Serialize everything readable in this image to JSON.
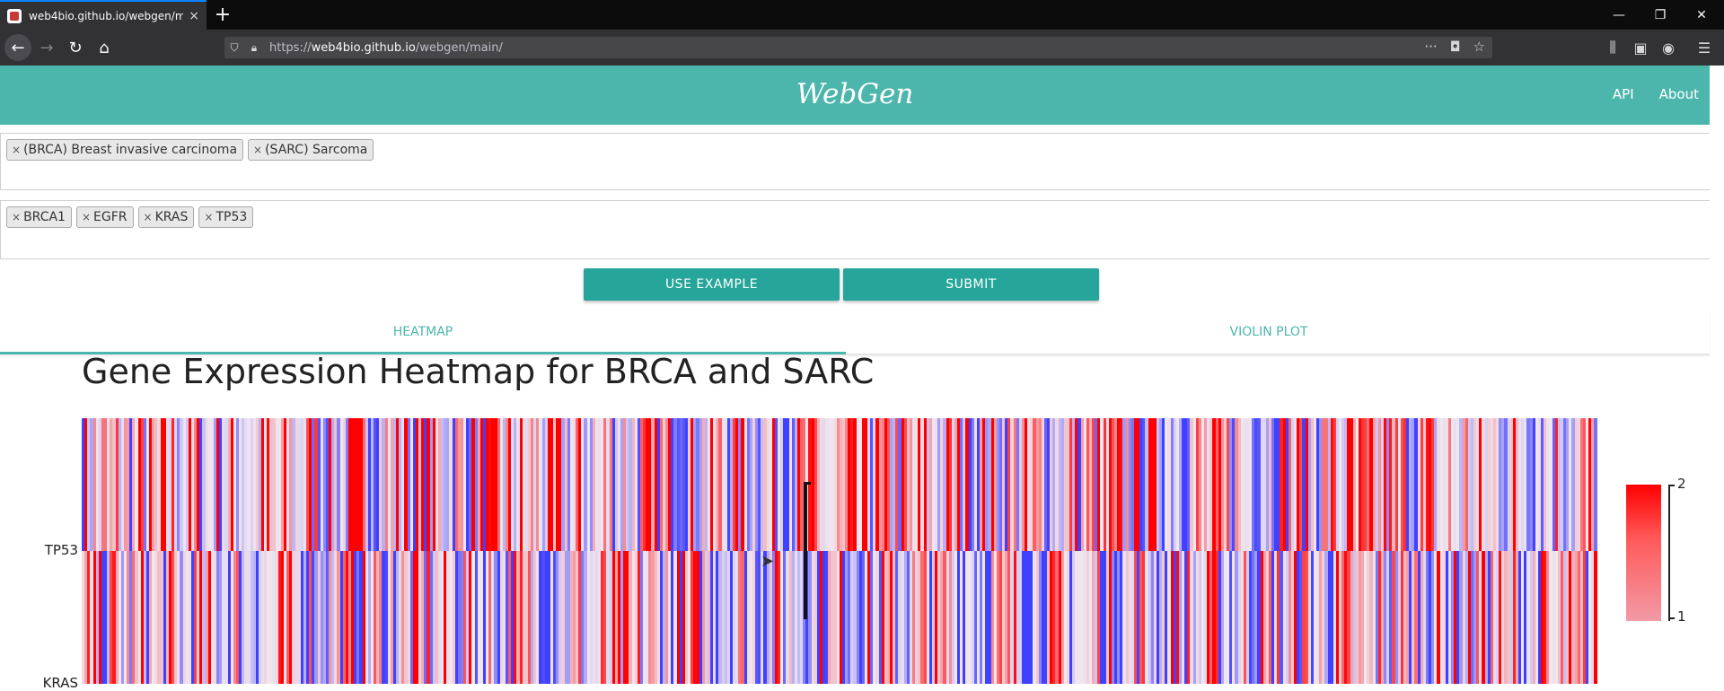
{
  "browser": {
    "tab_title": "web4bio.github.io/webgen/m…",
    "new_tab": "+",
    "url_scheme": "https://",
    "url_host": "web4bio.github.io",
    "url_path": "/webgen/main/"
  },
  "app": {
    "brand": "WebGen",
    "nav": [
      "API",
      "About"
    ]
  },
  "cancer_types": [
    {
      "label": "(BRCA) Breast invasive carcinoma"
    },
    {
      "label": "(SARC) Sarcoma"
    }
  ],
  "genes": [
    {
      "label": "BRCA1"
    },
    {
      "label": "EGFR"
    },
    {
      "label": "KRAS"
    },
    {
      "label": "TP53"
    }
  ],
  "buttons": {
    "use_example": "USE EXAMPLE",
    "submit": "SUBMIT"
  },
  "tabs": [
    {
      "label": "HEATMAP",
      "active": true
    },
    {
      "label": "VIOLIN PLOT",
      "active": false
    }
  ],
  "chart_data": {
    "type": "heatmap",
    "title": "Gene Expression Heatmap for BRCA and SARC",
    "rows": [
      "TP53",
      "KRAS"
    ],
    "colorbar_ticks": [
      2,
      1
    ],
    "color_high": "#ff0000",
    "color_mid": "#f0e6f0",
    "color_low": "#4040ff"
  },
  "colors": {
    "header": "#4db6ac",
    "button": "#26a69a"
  }
}
